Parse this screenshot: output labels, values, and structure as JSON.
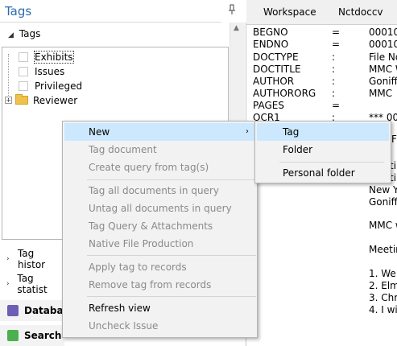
{
  "tags_panel": {
    "title": "Tags",
    "root_label": "Tags",
    "items": [
      {
        "label": "Exhibits"
      },
      {
        "label": "Issues"
      },
      {
        "label": "Privileged"
      },
      {
        "label": "Reviewer"
      }
    ],
    "side_rows": [
      "Tag histor",
      "Tag statist"
    ],
    "nav": [
      {
        "label": "Databa",
        "color": "#6b5fb5",
        "icon": "database-icon"
      },
      {
        "label": "Search",
        "color": "#4caf50",
        "icon": "search-icon"
      }
    ]
  },
  "doc": {
    "tabs": [
      "Workspace",
      "Nctdoccv"
    ],
    "fields": [
      {
        "key": "BEGNO",
        "sep": "=",
        "val": "00010"
      },
      {
        "key": "ENDNO",
        "sep": "=",
        "val": "00010"
      },
      {
        "key": "DOCTYPE",
        "sep": ":",
        "val": "File No"
      },
      {
        "key": "DOCTITLE",
        "sep": ":",
        "val": "MMC W"
      },
      {
        "key": "AUTHOR",
        "sep": ":",
        "val": "Goniff,"
      },
      {
        "key": "AUTHORORG",
        "sep": ":",
        "val": "MMC"
      },
      {
        "key": "PAGES",
        "sep": "=",
        "val": ""
      },
      {
        "key": "OCR1",
        "sep": ":",
        "val": "*** 000"
      }
    ],
    "text_lines": [
      "F",
      "tir",
      "ti",
      "New Y",
      "Goniff",
      "MMC w",
      "Meetir",
      "1. We",
      "2. Elm",
      "3. Chri",
      "4. I wil"
    ]
  },
  "context_menu": {
    "items": [
      {
        "label": "New",
        "disabled": false,
        "highlighted": true,
        "submenu": true
      },
      {
        "label": "Tag document",
        "disabled": true
      },
      {
        "label": "Create query from tag(s)",
        "disabled": true
      },
      {
        "label": "Tag all documents in query",
        "disabled": true
      },
      {
        "label": "Untag all documents in query",
        "disabled": true
      },
      {
        "label": "Tag Query & Attachments",
        "disabled": true
      },
      {
        "label": "Native File Production",
        "disabled": true
      },
      {
        "label": "Apply tag to records",
        "disabled": true
      },
      {
        "label": "Remove tag from records",
        "disabled": true
      },
      {
        "label": "Refresh view",
        "disabled": false
      },
      {
        "label": "Uncheck Issue",
        "disabled": true
      }
    ],
    "submenu_arrow": "›"
  },
  "submenu": {
    "items": [
      {
        "label": "Tag",
        "highlighted": true
      },
      {
        "label": "Folder"
      },
      {
        "label": "Personal folder"
      }
    ]
  }
}
